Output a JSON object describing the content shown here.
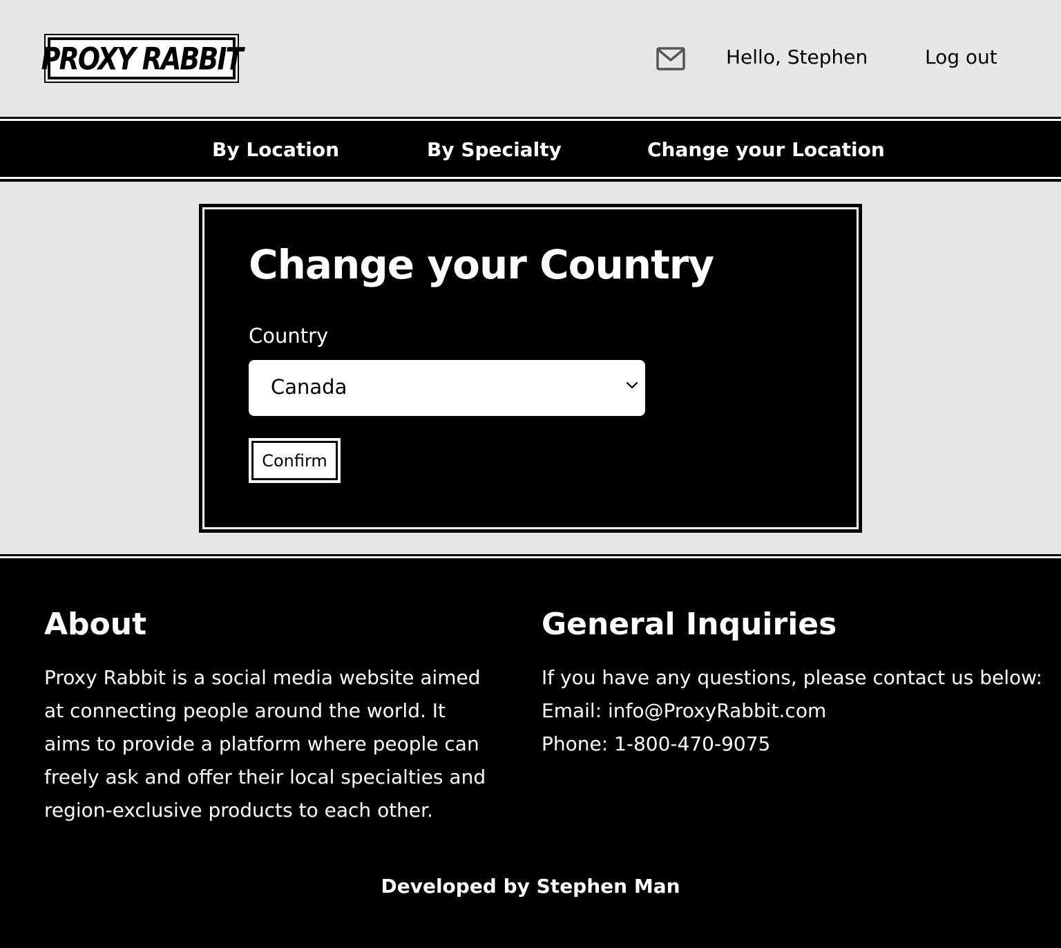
{
  "header": {
    "logo_text": "PROXY RABBIT",
    "mail_icon": "envelope-icon",
    "greeting": "Hello, Stephen",
    "logout_label": "Log out"
  },
  "nav": {
    "items": [
      {
        "label": "By Location"
      },
      {
        "label": "By Specialty"
      },
      {
        "label": "Change your Location"
      }
    ]
  },
  "main": {
    "title": "Change your Country",
    "country_label": "Country",
    "country_value": "Canada",
    "confirm_label": "Confirm"
  },
  "footer": {
    "about_heading": "About",
    "about_text": "Proxy Rabbit is a social media website aimed at connecting people around the world. It aims to provide a platform where people can freely ask and offer their local specialties and region-exclusive products to each other.",
    "inquiries_heading": "General Inquiries",
    "inquiries_intro": "If you have any questions, please contact us below:",
    "email_line": "Email: info@ProxyRabbit.com",
    "phone_line": "Phone: 1-800-470-9075",
    "developed_by": "Developed by Stephen Man"
  },
  "colors": {
    "page_background": "#e8e6e8",
    "dark": "#000000",
    "light": "#ffffff"
  }
}
